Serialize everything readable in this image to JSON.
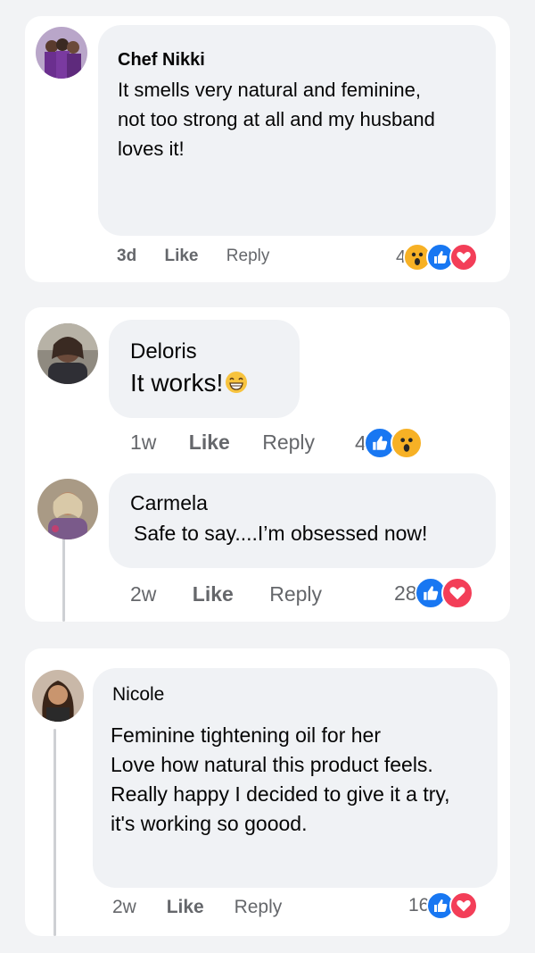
{
  "colors": {
    "like_blue": "#1877f2",
    "love_red": "#f33e58",
    "wow_yellow": "#f7b125",
    "meta_gray": "#65676b",
    "bubble_bg": "#f0f2f5"
  },
  "comments": [
    {
      "author": "Chef Nikki",
      "text_lines": [
        "It smells very natural and feminine,",
        "not too strong at all and my husband",
        "loves it!"
      ],
      "time": "3d",
      "like_label": "Like",
      "reply_label": "Reply",
      "reaction_count": "4",
      "reactions": [
        "wow-icon",
        "like-icon",
        "love-icon"
      ]
    },
    {
      "author": "Deloris",
      "text": "It works!",
      "emoji": "grinning-face-emoji",
      "time": "1w",
      "like_label": "Like",
      "reply_label": "Reply",
      "reaction_count": "4",
      "reactions": [
        "like-icon",
        "wow-icon"
      ]
    },
    {
      "author": "Carmela",
      "text": "Safe to say....I’m obsessed now!",
      "time": "2w",
      "like_label": "Like",
      "reply_label": "Reply",
      "reaction_count": "28",
      "reactions": [
        "like-icon",
        "love-icon"
      ]
    },
    {
      "author": "Nicole",
      "text_lines": [
        "Feminine tightening oil for her",
        "Love how natural this product feels.",
        "Really happy I decided to give it a try,",
        "it's working so goood."
      ],
      "time": "2w",
      "like_label": "Like",
      "reply_label": "Reply",
      "reaction_count": "16",
      "reactions": [
        "like-icon",
        "love-icon"
      ]
    }
  ]
}
